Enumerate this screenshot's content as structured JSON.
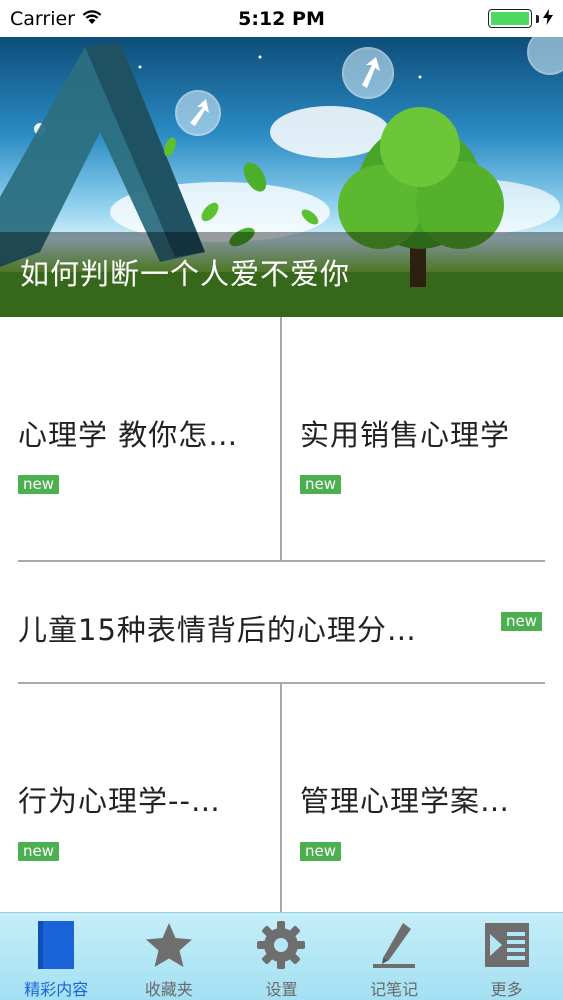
{
  "status_bar": {
    "carrier": "Carrier",
    "time": "5:12 PM"
  },
  "banner": {
    "caption": "如何判断一个人爱不爱你"
  },
  "tiles": [
    {
      "title": "心理学 教你怎…",
      "badge": "new"
    },
    {
      "title": "实用销售心理学",
      "badge": "new"
    },
    {
      "title": "儿童15种表情背后的心理分…",
      "badge": "new"
    },
    {
      "title": "行为心理学--…",
      "badge": "new"
    },
    {
      "title": "管理心理学案…",
      "badge": "new"
    }
  ],
  "tabbar": {
    "items": [
      {
        "label": "精彩内容",
        "icon": "document-icon",
        "active": true
      },
      {
        "label": "收藏夹",
        "icon": "star-icon",
        "active": false
      },
      {
        "label": "设置",
        "icon": "gear-icon",
        "active": false
      },
      {
        "label": "记笔记",
        "icon": "pen-icon",
        "active": false
      },
      {
        "label": "更多",
        "icon": "more-list-icon",
        "active": false
      }
    ]
  },
  "colors": {
    "accent": "#1a63d9",
    "badge": "#4caf50",
    "tabbar": "#b3e6f6",
    "battery": "#4cd964"
  }
}
